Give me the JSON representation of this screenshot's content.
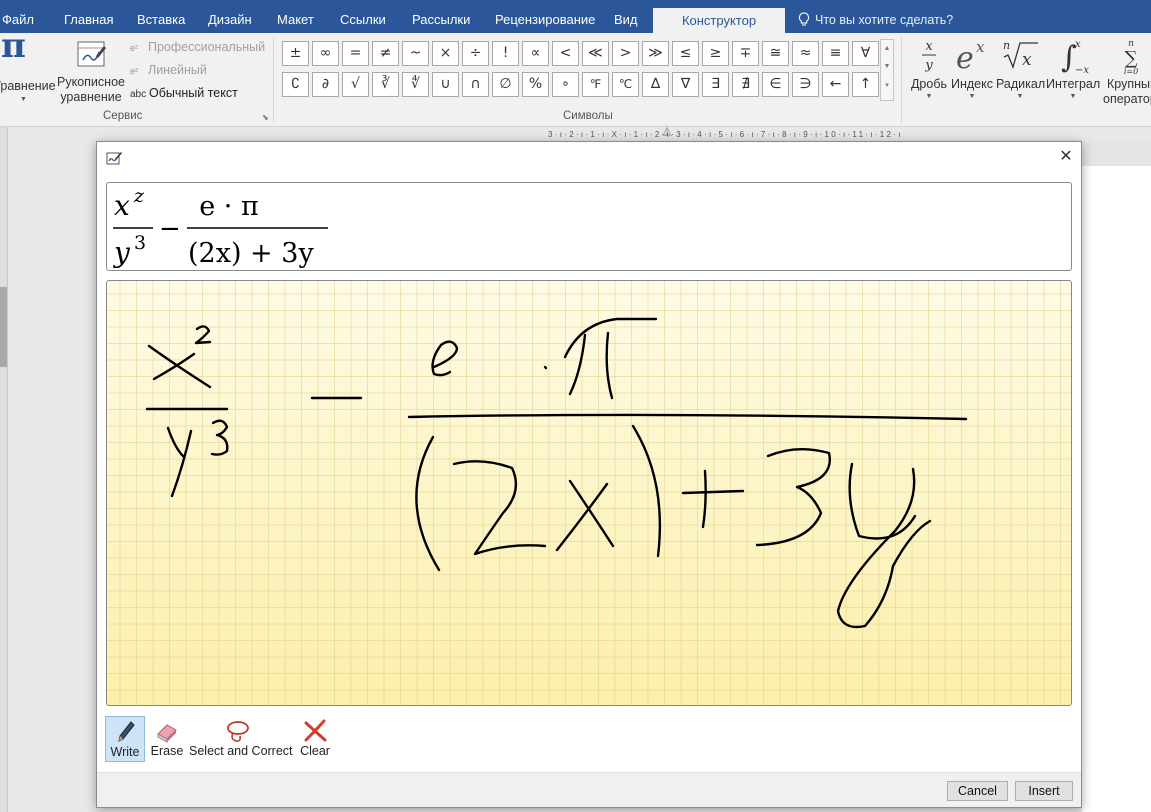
{
  "ribbon_tabs": [
    {
      "label": "Файл"
    },
    {
      "label": "Главная"
    },
    {
      "label": "Вставка"
    },
    {
      "label": "Дизайн"
    },
    {
      "label": "Макет"
    },
    {
      "label": "Ссылки"
    },
    {
      "label": "Рассылки"
    },
    {
      "label": "Рецензирование"
    },
    {
      "label": "Вид"
    },
    {
      "label": "Конструктор",
      "active": true
    }
  ],
  "tell_me": "Что вы хотите сделать?",
  "tools_group": {
    "equation_label": "Уравнение",
    "ink_label_1": "Рукописное",
    "ink_label_2": "уравнение",
    "professional": "Профессиональный",
    "linear": "Линейный",
    "normal_text": "Обычный текст",
    "normal_text_icon": "abc",
    "group_label": "Сервис"
  },
  "symbols": {
    "row1": [
      "±",
      "∞",
      "=",
      "≠",
      "~",
      "×",
      "÷",
      "!",
      "∝",
      "<",
      "≪",
      ">",
      "≫",
      "≤",
      "≥",
      "∓",
      "≅",
      "≈",
      "≡",
      "∀"
    ],
    "row2": [
      "∁",
      "∂",
      "√",
      "∛",
      "∜",
      "∪",
      "∩",
      "∅",
      "%",
      "∘",
      "℉",
      "℃",
      "∆",
      "∇",
      "∃",
      "∄",
      "∈",
      "∋",
      "←",
      "↑"
    ],
    "group_label": "Символы"
  },
  "structures": [
    {
      "label": "Дробь",
      "icon": "fraction-icon"
    },
    {
      "label": "Индекс",
      "icon": "script-icon"
    },
    {
      "label": "Радикал",
      "icon": "radical-icon"
    },
    {
      "label": "Интеграл",
      "icon": "integral-icon"
    },
    {
      "label": "Крупный",
      "label2": "оператор",
      "icon": "large-operator-icon"
    }
  ],
  "ruler_text": "3·ı·2·ı·1·ı·X·ı·1·ı·2·ı·3·ı·4·ı·5·ı·6·ı·7·ı·8·ı·9·ı·10·ı·11·ı·12·ı",
  "dialog": {
    "preview": {
      "num1_base": "x",
      "num1_exp": "z",
      "den1_base": "y",
      "den1_exp": "3",
      "minus": "−",
      "num2": "e · π",
      "den2": "(2x) + 3y"
    },
    "tools": [
      {
        "label": "Write",
        "icon": "pen-icon",
        "active": true
      },
      {
        "label": "Erase",
        "icon": "eraser-icon",
        "active": false
      },
      {
        "label": "Select and Correct",
        "icon": "lasso-icon",
        "active": false
      },
      {
        "label": "Clear",
        "icon": "clear-x-icon",
        "active": false
      }
    ],
    "cancel_label": "Cancel",
    "insert_label": "Insert"
  }
}
